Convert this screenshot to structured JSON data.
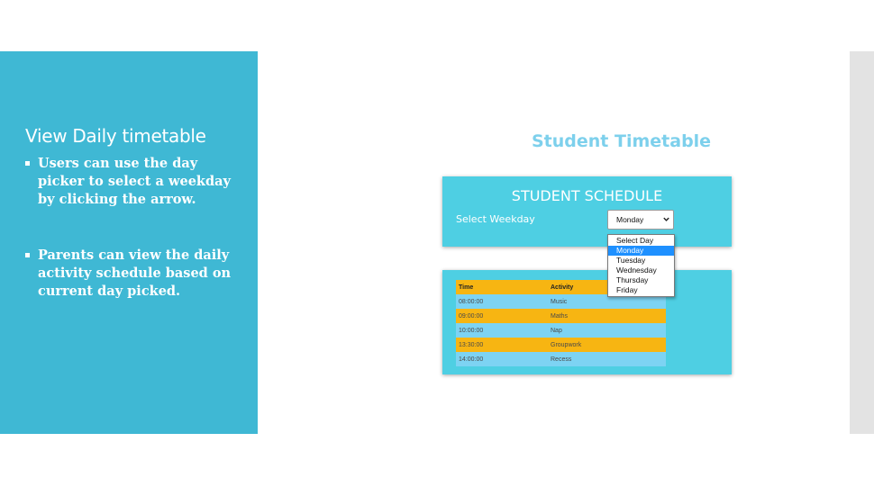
{
  "left_panel": {
    "title": "View Daily timetable",
    "bullets": [
      "Users can use the day picker to select a weekday by clicking the arrow.",
      "Parents can view the daily activity schedule based on current day picked."
    ]
  },
  "main": {
    "heading": "Student Timetable",
    "schedule_title": "STUDENT SCHEDULE",
    "weekday_label": "Select Weekday",
    "select_value": "Monday",
    "dropdown_options": [
      "Select Day",
      "Monday",
      "Tuesday",
      "Wednesday",
      "Thursday",
      "Friday"
    ],
    "dropdown_selected_index": 1,
    "table": {
      "headers": [
        "Time",
        "Activity"
      ],
      "rows": [
        {
          "time": "08:00:00",
          "activity": "Music"
        },
        {
          "time": "09:00:00",
          "activity": "Maths"
        },
        {
          "time": "10:00:00",
          "activity": "Nap"
        },
        {
          "time": "13:30:00",
          "activity": "Groupwork"
        },
        {
          "time": "14:00:00",
          "activity": "Recess"
        }
      ]
    }
  },
  "colors": {
    "panel": "#3fb8d4",
    "card": "#4ecfe3",
    "heading": "#7dd0ec",
    "row_blue": "#7dd3f3",
    "row_orange": "#f7b512",
    "selected_option": "#1e90ff"
  }
}
